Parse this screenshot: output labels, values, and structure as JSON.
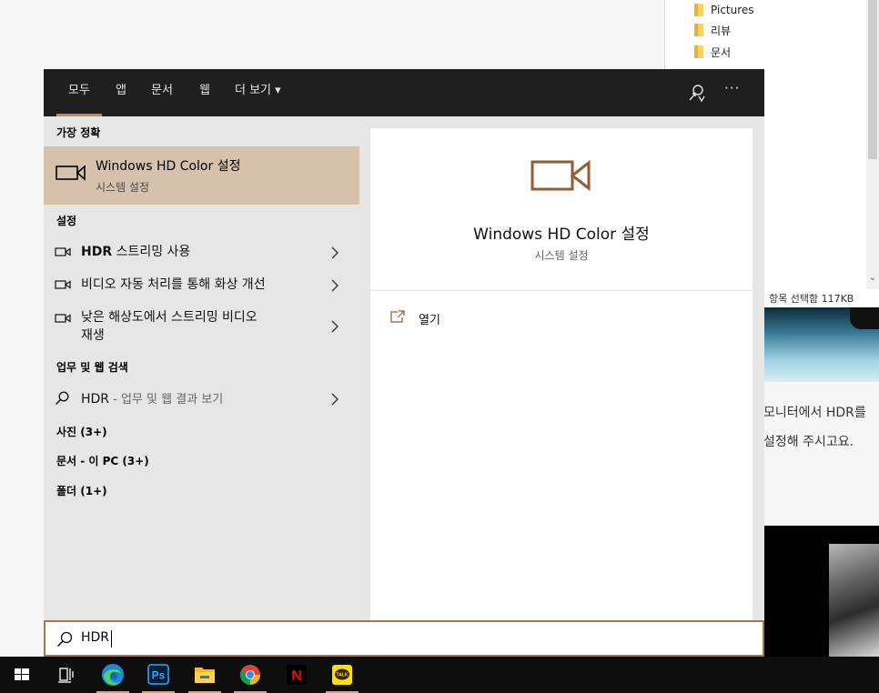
{
  "explorer": {
    "folders": [
      "Pictures",
      "리뷰",
      "문서"
    ],
    "status_text": "항목 선택함 117KB"
  },
  "web_page": {
    "text_lines": [
      "모니터에서 HDR를",
      "설정해 주시고요."
    ]
  },
  "search_menu": {
    "tabs": [
      {
        "label": "모두",
        "active": true
      },
      {
        "label": "앱"
      },
      {
        "label": "문서"
      },
      {
        "label": "웹"
      },
      {
        "label": "더 보기 ▾"
      }
    ],
    "more_icon_glyph": "···",
    "sections": {
      "best_match": "가장 정확",
      "settings": "설정",
      "web": "업무 및 웹 검색",
      "photos": "사진 (3+)",
      "documents": "문서 - 이 PC (3+)",
      "folders": "폴더 (1+)"
    },
    "best_match": {
      "title": "Windows HD Color 설정",
      "subtitle": "시스템 설정",
      "icon": "monitor-camera-icon"
    },
    "settings_results": [
      {
        "bold": "HDR",
        "text": " 스트리밍 사용"
      },
      {
        "bold": "",
        "text": "비디오 자동 처리를 통해 화상 개선"
      },
      {
        "bold": "",
        "text": "낮은 해상도에서 스트리밍 비디오",
        "line2": "재생"
      }
    ],
    "web_result": {
      "query": "HDR",
      "suffix": " - 업무 및 웹 결과 보기"
    },
    "preview": {
      "title": "Windows HD Color 설정",
      "subtitle": "시스템 설정",
      "open_label": "열기"
    },
    "search_box": {
      "value": "HDR"
    }
  },
  "taskbar": {
    "items": [
      "start-icon",
      "task-view-icon",
      "edge-icon",
      "photoshop-icon",
      "file-explorer-icon",
      "chrome-icon",
      "netflix-icon",
      "kakaotalk-icon"
    ],
    "photoshop_text": "Ps",
    "netflix_text": "N",
    "kakaotalk_text": "TALK"
  },
  "colors": {
    "accent": "#c08e5c",
    "selection": "#d6c1ad",
    "nav_bg": "#1f1f1f",
    "panel_bg": "#e6e6e6",
    "taskbar_bg": "#0e0e0e"
  }
}
